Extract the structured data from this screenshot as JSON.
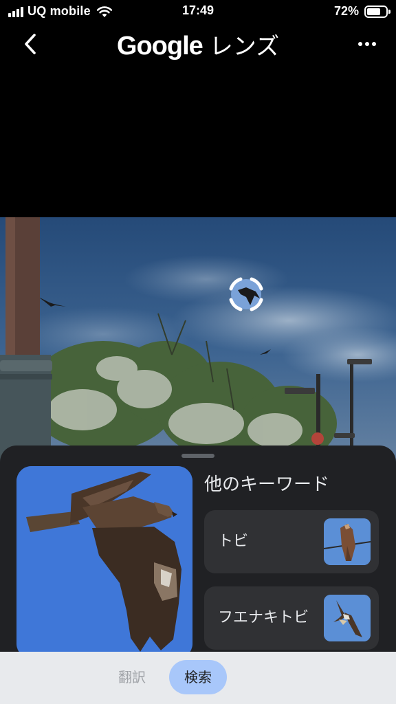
{
  "status_bar": {
    "carrier": "UQ mobile",
    "time": "17:49",
    "battery": "72%",
    "battery_level": 0.72
  },
  "header": {
    "title_brand": "Google",
    "title_product": "レンズ",
    "back_icon": "chevron-left-icon",
    "more_icon": "more-horizontal-icon"
  },
  "results": {
    "main_result_icon": "kite-photo",
    "section_title": "他のキーワード",
    "keywords": [
      {
        "label": "トビ"
      },
      {
        "label": "フエナキトビ"
      }
    ]
  },
  "tabs": {
    "translate": "翻訳",
    "search": "検索",
    "selected": "search"
  },
  "colors": {
    "sheet_bg": "#202124",
    "card_bg": "#303134",
    "tab_bar_bg": "#e8eaed",
    "selected_tab_bg": "#a8c7fa"
  }
}
